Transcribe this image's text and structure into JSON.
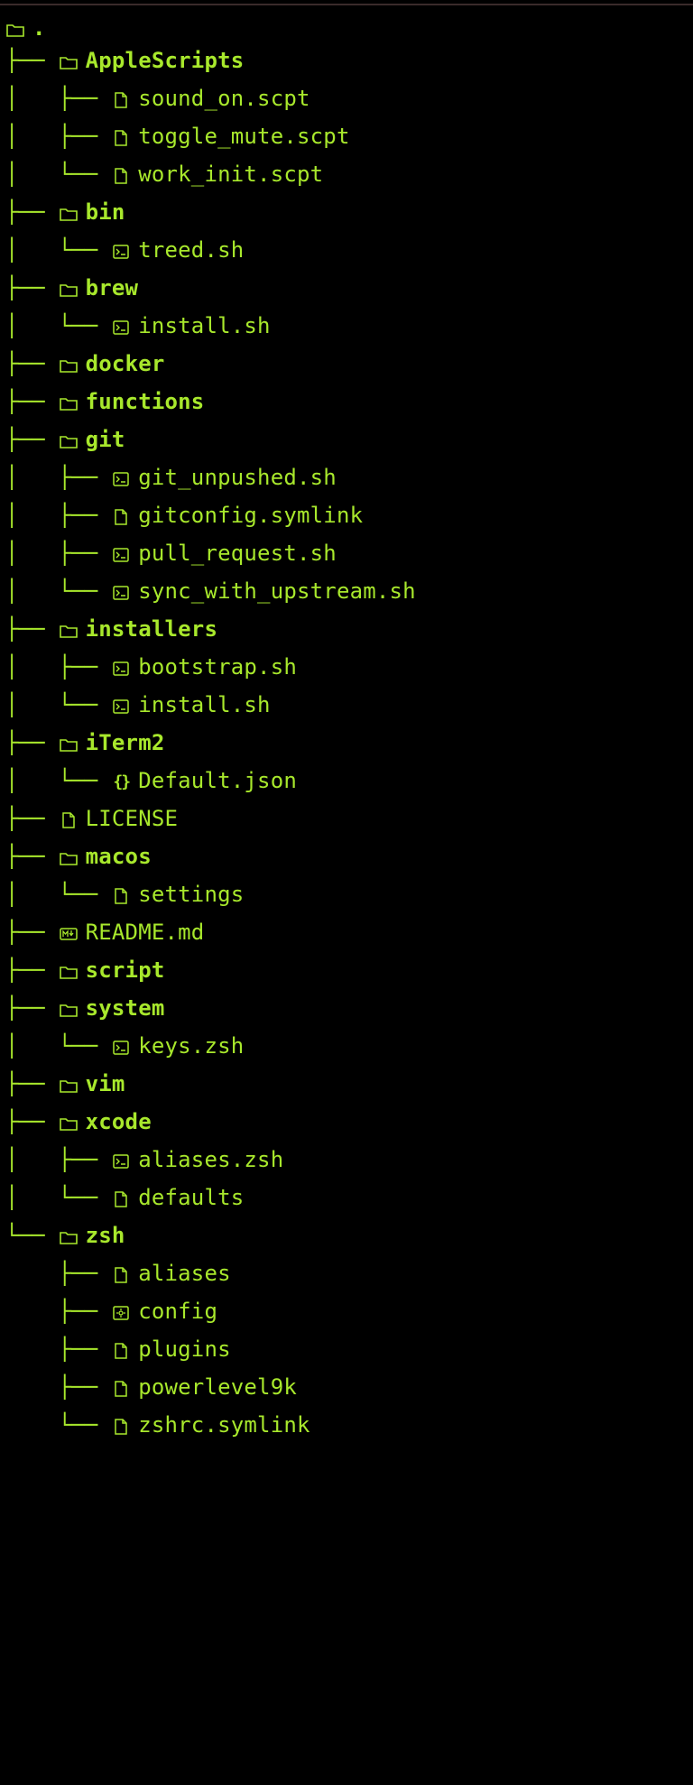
{
  "root": {
    "icon": "folder",
    "label": "."
  },
  "rows": [
    {
      "prefix": "├── ",
      "icon": "folder",
      "bold": true,
      "label": "AppleScripts"
    },
    {
      "prefix": "│   ├── ",
      "icon": "file",
      "bold": false,
      "label": "sound_on.scpt"
    },
    {
      "prefix": "│   ├── ",
      "icon": "file",
      "bold": false,
      "label": "toggle_mute.scpt"
    },
    {
      "prefix": "│   └── ",
      "icon": "file",
      "bold": false,
      "label": "work_init.scpt"
    },
    {
      "prefix": "├── ",
      "icon": "folder",
      "bold": true,
      "label": "bin"
    },
    {
      "prefix": "│   └── ",
      "icon": "shell",
      "bold": false,
      "label": "treed.sh"
    },
    {
      "prefix": "├── ",
      "icon": "folder",
      "bold": true,
      "label": "brew"
    },
    {
      "prefix": "│   └── ",
      "icon": "shell",
      "bold": false,
      "label": "install.sh"
    },
    {
      "prefix": "├── ",
      "icon": "folder",
      "bold": true,
      "label": "docker"
    },
    {
      "prefix": "├── ",
      "icon": "folder",
      "bold": true,
      "label": "functions"
    },
    {
      "prefix": "├── ",
      "icon": "folder",
      "bold": true,
      "label": "git"
    },
    {
      "prefix": "│   ├── ",
      "icon": "shell",
      "bold": false,
      "label": "git_unpushed.sh"
    },
    {
      "prefix": "│   ├── ",
      "icon": "file",
      "bold": false,
      "label": "gitconfig.symlink"
    },
    {
      "prefix": "│   ├── ",
      "icon": "shell",
      "bold": false,
      "label": "pull_request.sh"
    },
    {
      "prefix": "│   └── ",
      "icon": "shell",
      "bold": false,
      "label": "sync_with_upstream.sh"
    },
    {
      "prefix": "├── ",
      "icon": "folder",
      "bold": true,
      "label": "installers"
    },
    {
      "prefix": "│   ├── ",
      "icon": "shell",
      "bold": false,
      "label": "bootstrap.sh"
    },
    {
      "prefix": "│   └── ",
      "icon": "shell",
      "bold": false,
      "label": "install.sh"
    },
    {
      "prefix": "├── ",
      "icon": "folder",
      "bold": true,
      "label": "iTerm2"
    },
    {
      "prefix": "│   └── ",
      "icon": "json",
      "bold": false,
      "label": "Default.json"
    },
    {
      "prefix": "├── ",
      "icon": "file",
      "bold": false,
      "label": "LICENSE"
    },
    {
      "prefix": "├── ",
      "icon": "folder",
      "bold": true,
      "label": "macos"
    },
    {
      "prefix": "│   └── ",
      "icon": "file",
      "bold": false,
      "label": "settings"
    },
    {
      "prefix": "├── ",
      "icon": "md",
      "bold": false,
      "label": "README.md"
    },
    {
      "prefix": "├── ",
      "icon": "folder",
      "bold": true,
      "label": "script"
    },
    {
      "prefix": "├── ",
      "icon": "folder",
      "bold": true,
      "label": "system"
    },
    {
      "prefix": "│   └── ",
      "icon": "shell",
      "bold": false,
      "label": "keys.zsh"
    },
    {
      "prefix": "├── ",
      "icon": "folder",
      "bold": true,
      "label": "vim"
    },
    {
      "prefix": "├── ",
      "icon": "folder",
      "bold": true,
      "label": "xcode"
    },
    {
      "prefix": "│   ├── ",
      "icon": "shell",
      "bold": false,
      "label": "aliases.zsh"
    },
    {
      "prefix": "│   └── ",
      "icon": "file",
      "bold": false,
      "label": "defaults"
    },
    {
      "prefix": "└── ",
      "icon": "folder",
      "bold": true,
      "label": "zsh"
    },
    {
      "prefix": "    ├── ",
      "icon": "file",
      "bold": false,
      "label": "aliases"
    },
    {
      "prefix": "    ├── ",
      "icon": "config",
      "bold": false,
      "label": "config"
    },
    {
      "prefix": "    ├── ",
      "icon": "file",
      "bold": false,
      "label": "plugins"
    },
    {
      "prefix": "    ├── ",
      "icon": "file",
      "bold": false,
      "label": "powerlevel9k"
    },
    {
      "prefix": "    └── ",
      "icon": "file",
      "bold": false,
      "label": "zshrc.symlink"
    }
  ],
  "icons": {
    "folder": "🗁",
    "file": "🗋",
    "shell": "⧉",
    "json": "{}",
    "md": "▮",
    "config": "🗂"
  }
}
